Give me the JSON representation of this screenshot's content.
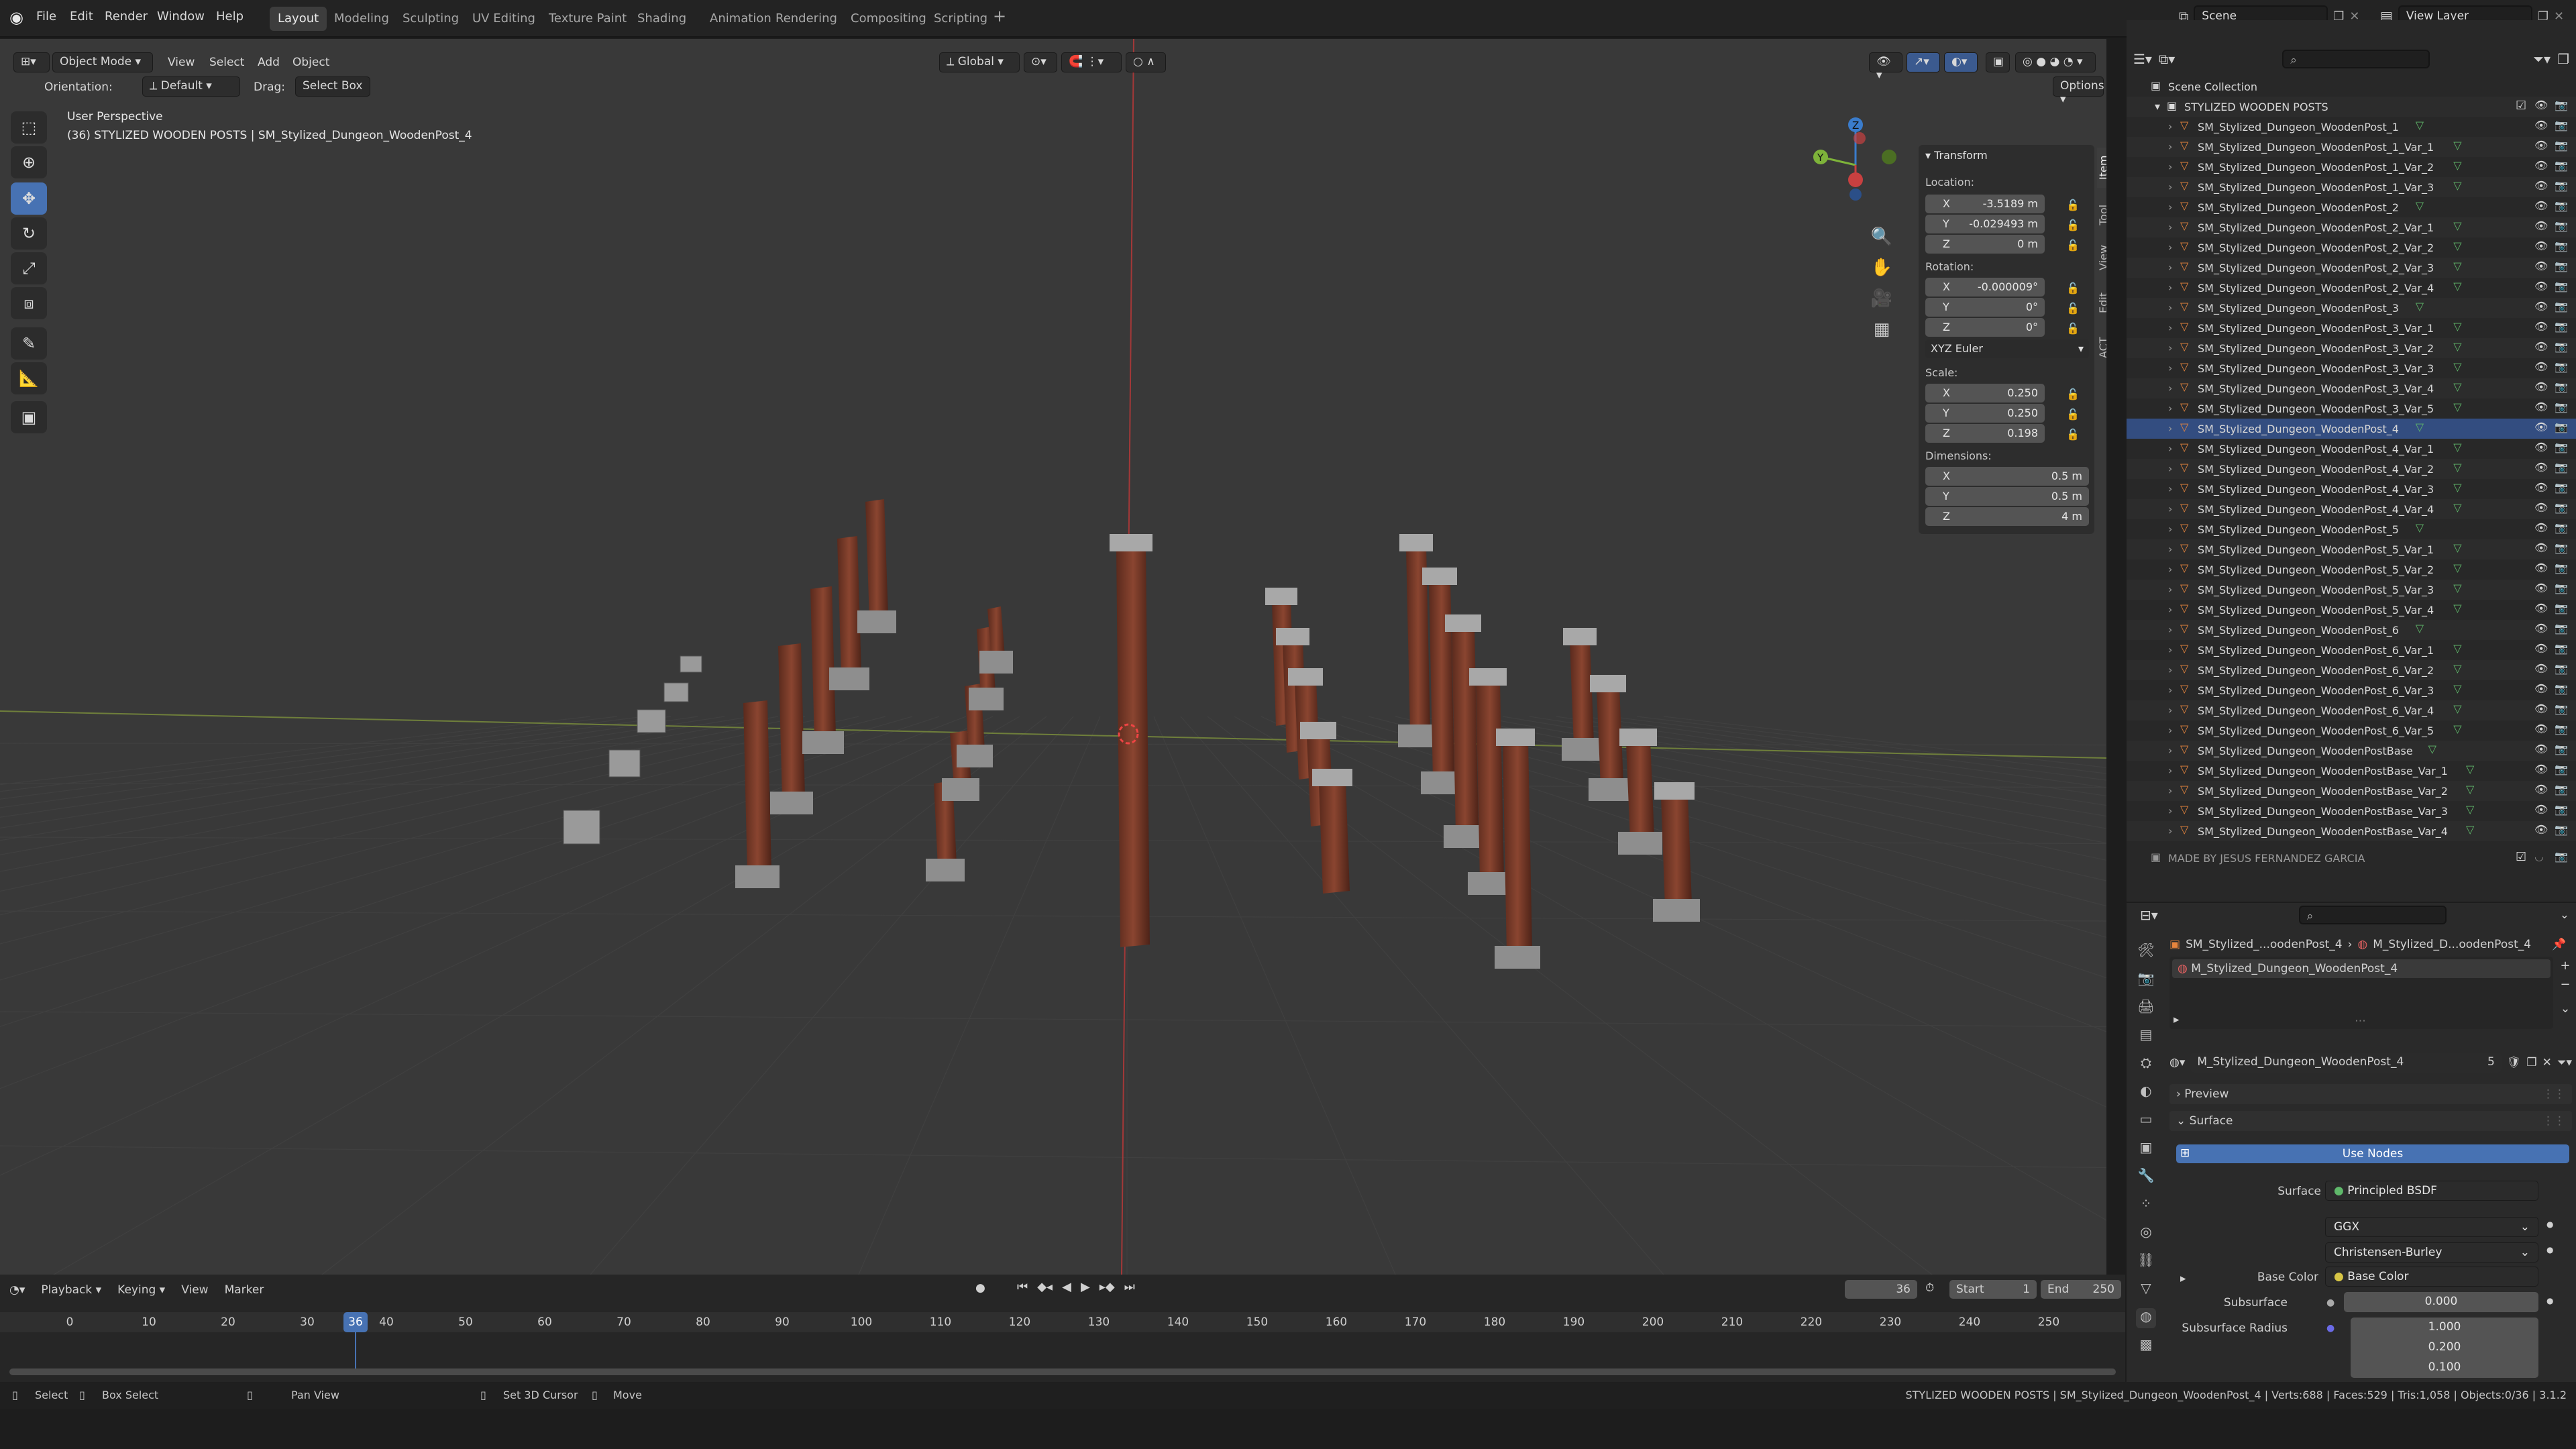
{
  "menu": {
    "file": "File",
    "edit": "Edit",
    "render": "Render",
    "window": "Window",
    "help": "Help"
  },
  "workspaces": [
    "Layout",
    "Modeling",
    "Sculpting",
    "UV Editing",
    "Texture Paint",
    "Shading",
    "Animation",
    "Rendering",
    "Compositing",
    "Scripting"
  ],
  "workspace_add": "+",
  "scene": {
    "name": "Scene",
    "view_layer": "View Layer"
  },
  "viewport": {
    "mode": "Object Mode",
    "view": "View",
    "select": "Select",
    "add": "Add",
    "object": "Object",
    "orientation_label": "Orientation:",
    "orientation_value": "Default",
    "drag_label": "Drag:",
    "drag_value": "Select Box",
    "transform_orientation": "Global",
    "options": "Options",
    "perspective": "User Perspective",
    "active_info": "(36) STYLIZED WOODEN POSTS | SM_Stylized_Dungeon_WoodenPost_4"
  },
  "gizmo": {
    "x": "X",
    "y": "Y",
    "z": "Z"
  },
  "npanel": {
    "title": "Transform",
    "location_label": "Location:",
    "location": {
      "x": "-3.5189 m",
      "y": "-0.029493 m",
      "z": "0 m"
    },
    "rotation_label": "Rotation:",
    "rotation": {
      "x": "-0.000009°",
      "y": "0°",
      "z": "0°"
    },
    "rotation_mode": "XYZ Euler",
    "scale_label": "Scale:",
    "scale": {
      "x": "0.250",
      "y": "0.250",
      "z": "0.198"
    },
    "dimensions_label": "Dimensions:",
    "dimensions": {
      "x": "0.5 m",
      "y": "0.5 m",
      "z": "4 m"
    },
    "axis": {
      "x": "X",
      "y": "Y",
      "z": "Z"
    },
    "tabs": [
      "Item",
      "Tool",
      "View",
      "Edit",
      "ACT"
    ]
  },
  "outliner": {
    "root": "Scene Collection",
    "collection": "STYLIZED WOODEN POSTS",
    "items": [
      "SM_Stylized_Dungeon_WoodenPost_1",
      "SM_Stylized_Dungeon_WoodenPost_1_Var_1",
      "SM_Stylized_Dungeon_WoodenPost_1_Var_2",
      "SM_Stylized_Dungeon_WoodenPost_1_Var_3",
      "SM_Stylized_Dungeon_WoodenPost_2",
      "SM_Stylized_Dungeon_WoodenPost_2_Var_1",
      "SM_Stylized_Dungeon_WoodenPost_2_Var_2",
      "SM_Stylized_Dungeon_WoodenPost_2_Var_3",
      "SM_Stylized_Dungeon_WoodenPost_2_Var_4",
      "SM_Stylized_Dungeon_WoodenPost_3",
      "SM_Stylized_Dungeon_WoodenPost_3_Var_1",
      "SM_Stylized_Dungeon_WoodenPost_3_Var_2",
      "SM_Stylized_Dungeon_WoodenPost_3_Var_3",
      "SM_Stylized_Dungeon_WoodenPost_3_Var_4",
      "SM_Stylized_Dungeon_WoodenPost_3_Var_5",
      "SM_Stylized_Dungeon_WoodenPost_4",
      "SM_Stylized_Dungeon_WoodenPost_4_Var_1",
      "SM_Stylized_Dungeon_WoodenPost_4_Var_2",
      "SM_Stylized_Dungeon_WoodenPost_4_Var_3",
      "SM_Stylized_Dungeon_WoodenPost_4_Var_4",
      "SM_Stylized_Dungeon_WoodenPost_5",
      "SM_Stylized_Dungeon_WoodenPost_5_Var_1",
      "SM_Stylized_Dungeon_WoodenPost_5_Var_2",
      "SM_Stylized_Dungeon_WoodenPost_5_Var_3",
      "SM_Stylized_Dungeon_WoodenPost_5_Var_4",
      "SM_Stylized_Dungeon_WoodenPost_6",
      "SM_Stylized_Dungeon_WoodenPost_6_Var_1",
      "SM_Stylized_Dungeon_WoodenPost_6_Var_2",
      "SM_Stylized_Dungeon_WoodenPost_6_Var_3",
      "SM_Stylized_Dungeon_WoodenPost_6_Var_4",
      "SM_Stylized_Dungeon_WoodenPost_6_Var_5",
      "SM_Stylized_Dungeon_WoodenPostBase",
      "SM_Stylized_Dungeon_WoodenPostBase_Var_1",
      "SM_Stylized_Dungeon_WoodenPostBase_Var_2",
      "SM_Stylized_Dungeon_WoodenPostBase_Var_3",
      "SM_Stylized_Dungeon_WoodenPostBase_Var_4"
    ],
    "selected_index": 15,
    "footer": "MADE BY JESUS FERNANDEZ GARCIA"
  },
  "properties": {
    "breadcrumb_object": "SM_Stylized_...oodenPost_4",
    "breadcrumb_material": "M_Stylized_D...oodenPost_4",
    "slot": "M_Stylized_Dungeon_WoodenPost_4",
    "material_name": "M_Stylized_Dungeon_WoodenPost_4",
    "user_count": "5",
    "preview": "Preview",
    "surface_section": "Surface",
    "use_nodes": "Use Nodes",
    "surface_label": "Surface",
    "surface_value": "Principled BSDF",
    "distribution": "GGX",
    "subsurface_method": "Christensen-Burley",
    "base_color_label": "Base Color",
    "base_color_value": "Base Color",
    "subsurface_label": "Subsurface",
    "subsurface_value": "0.000",
    "subsurface_radius_label": "Subsurface Radius",
    "subsurface_radius": [
      "1.000",
      "0.200",
      "0.100"
    ]
  },
  "timeline": {
    "playback": "Playback",
    "keying": "Keying",
    "view": "View",
    "marker": "Marker",
    "current_frame": "36",
    "start_label": "Start",
    "start": "1",
    "end_label": "End",
    "end": "250",
    "ticks": [
      "0",
      "10",
      "20",
      "30",
      "36",
      "40",
      "50",
      "60",
      "70",
      "80",
      "90",
      "100",
      "110",
      "120",
      "130",
      "140",
      "150",
      "160",
      "170",
      "180",
      "190",
      "200",
      "210",
      "220",
      "230",
      "240",
      "250"
    ]
  },
  "status": {
    "select": "Select",
    "box_select": "Box Select",
    "pan_view": "Pan View",
    "set_cursor": "Set 3D Cursor",
    "move": "Move",
    "info": "STYLIZED WOODEN POSTS | SM_Stylized_Dungeon_WoodenPost_4 | Verts:688 | Faces:529 | Tris:1,058 | Objects:0/36 | 3.1.2"
  },
  "colors": {
    "accent": "#4772b3",
    "selected_row": "#334d80",
    "wood": "#7a3c2a",
    "mesh_icon": "#e8853d",
    "data_icon": "#5fb86a"
  }
}
